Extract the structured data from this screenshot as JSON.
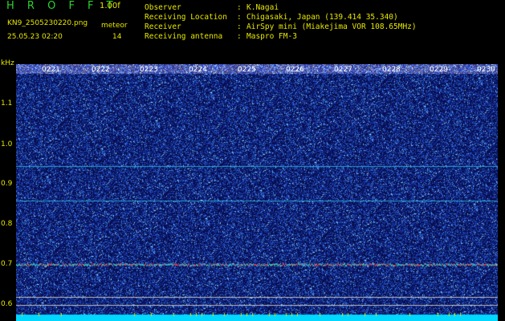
{
  "header": {
    "app_title": "H R O F F T",
    "version": "1.00f",
    "filename": "KN9_2505230220.png",
    "datetime": "25.05.23 02:20",
    "meteor_label": "meteor",
    "meteor_count": "14"
  },
  "info": [
    {
      "key": "Observer",
      "value": "K.Nagai"
    },
    {
      "key": "Receiving Location",
      "value": "Chigasaki, Japan (139.414 35.340)"
    },
    {
      "key": "Receiver",
      "value": "AirSpy mini (Miakejima VOR 108.65MHz)"
    },
    {
      "key": "Receiving antenna",
      "value": "Maspro FM-3"
    }
  ],
  "spectrogram": {
    "unit_label": "kHz",
    "y_ticks": [
      "1.1",
      "1.0",
      "0.9",
      "0.8",
      "0.7",
      "0.6"
    ],
    "time_labels": [
      "0221",
      "0222",
      "0223",
      "0224",
      "0225",
      "0226",
      "0227",
      "0228",
      "0229",
      "0230"
    ],
    "background_color": "#0a1060",
    "noise_color": "#1a3aa8",
    "carrier_color": "#2a9fd0",
    "bottom_bar_color": "#00d8ff"
  }
}
